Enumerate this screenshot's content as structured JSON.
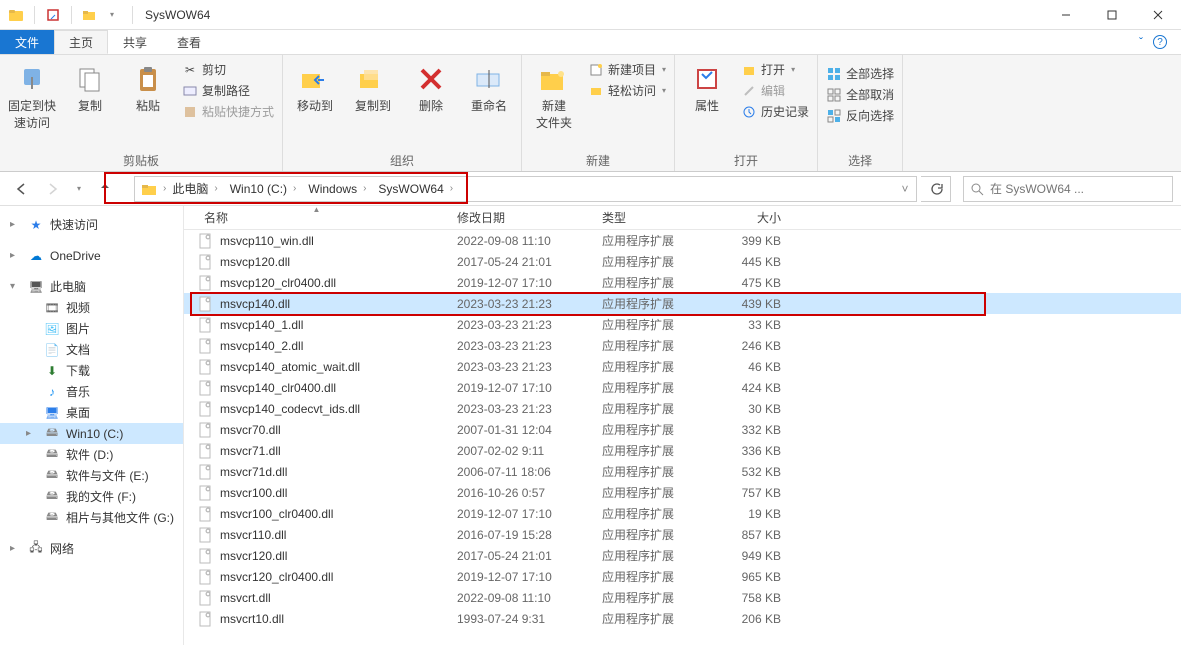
{
  "window": {
    "title": "SysWOW64"
  },
  "tabs": {
    "file": "文件",
    "home": "主页",
    "share": "共享",
    "view": "查看"
  },
  "ribbon": {
    "clipboard": {
      "pin": "固定到快\n速访问",
      "copy": "复制",
      "paste": "粘贴",
      "cut": "剪切",
      "copypath": "复制路径",
      "pasteshortcut": "粘贴快捷方式",
      "label": "剪贴板"
    },
    "organize": {
      "moveto": "移动到",
      "copyto": "复制到",
      "delete": "删除",
      "rename": "重命名",
      "label": "组织"
    },
    "new": {
      "newfolder": "新建\n文件夹",
      "newitem": "新建项目",
      "easyaccess": "轻松访问",
      "label": "新建"
    },
    "open": {
      "properties": "属性",
      "open": "打开",
      "edit": "编辑",
      "history": "历史记录",
      "label": "打开"
    },
    "select": {
      "selectall": "全部选择",
      "selectnone": "全部取消",
      "invert": "反向选择",
      "label": "选择"
    }
  },
  "breadcrumbs": [
    "此电脑",
    "Win10 (C:)",
    "Windows",
    "SysWOW64"
  ],
  "search_placeholder": "在 SysWOW64 ...",
  "columns": {
    "name": "名称",
    "date": "修改日期",
    "type": "类型",
    "size": "大小"
  },
  "sidebar": [
    {
      "label": "快速访问",
      "icon": "star",
      "exp": "▸",
      "lvl": 0,
      "color": "#2b7de9"
    },
    {
      "gap": true
    },
    {
      "label": "OneDrive",
      "icon": "cloud",
      "exp": "▸",
      "lvl": 0,
      "color": "#0078d4"
    },
    {
      "gap": true
    },
    {
      "label": "此电脑",
      "icon": "pc",
      "exp": "▾",
      "lvl": 0,
      "color": "#555"
    },
    {
      "label": "视频",
      "icon": "video",
      "lvl": 1,
      "color": "#555"
    },
    {
      "label": "图片",
      "icon": "pic",
      "lvl": 1,
      "color": "#4fc3f7"
    },
    {
      "label": "文档",
      "icon": "doc",
      "lvl": 1,
      "color": "#555"
    },
    {
      "label": "下载",
      "icon": "dl",
      "lvl": 1,
      "color": "#2e7d32"
    },
    {
      "label": "音乐",
      "icon": "music",
      "lvl": 1,
      "color": "#2196f3"
    },
    {
      "label": "桌面",
      "icon": "desktop",
      "lvl": 1,
      "color": "#2b7de9"
    },
    {
      "label": "Win10 (C:)",
      "icon": "drive",
      "exp": "▸",
      "lvl": 1,
      "selected": true,
      "color": "#888"
    },
    {
      "label": "软件 (D:)",
      "icon": "drive",
      "lvl": 1,
      "color": "#888"
    },
    {
      "label": "软件与文件 (E:)",
      "icon": "drive",
      "lvl": 1,
      "color": "#888"
    },
    {
      "label": "我的文件 (F:)",
      "icon": "drive",
      "lvl": 1,
      "color": "#888"
    },
    {
      "label": "相片与其他文件 (G:)",
      "icon": "drive",
      "lvl": 1,
      "color": "#888"
    },
    {
      "gap": true
    },
    {
      "label": "网络",
      "icon": "net",
      "exp": "▸",
      "lvl": 0,
      "color": "#555"
    }
  ],
  "files": [
    {
      "name": "msvcp110_win.dll",
      "date": "2022-09-08 11:10",
      "type": "应用程序扩展",
      "size": "399 KB"
    },
    {
      "name": "msvcp120.dll",
      "date": "2017-05-24 21:01",
      "type": "应用程序扩展",
      "size": "445 KB"
    },
    {
      "name": "msvcp120_clr0400.dll",
      "date": "2019-12-07 17:10",
      "type": "应用程序扩展",
      "size": "475 KB"
    },
    {
      "name": "msvcp140.dll",
      "date": "2023-03-23 21:23",
      "type": "应用程序扩展",
      "size": "439 KB",
      "selected": true
    },
    {
      "name": "msvcp140_1.dll",
      "date": "2023-03-23 21:23",
      "type": "应用程序扩展",
      "size": "33 KB"
    },
    {
      "name": "msvcp140_2.dll",
      "date": "2023-03-23 21:23",
      "type": "应用程序扩展",
      "size": "246 KB"
    },
    {
      "name": "msvcp140_atomic_wait.dll",
      "date": "2023-03-23 21:23",
      "type": "应用程序扩展",
      "size": "46 KB"
    },
    {
      "name": "msvcp140_clr0400.dll",
      "date": "2019-12-07 17:10",
      "type": "应用程序扩展",
      "size": "424 KB"
    },
    {
      "name": "msvcp140_codecvt_ids.dll",
      "date": "2023-03-23 21:23",
      "type": "应用程序扩展",
      "size": "30 KB"
    },
    {
      "name": "msvcr70.dll",
      "date": "2007-01-31 12:04",
      "type": "应用程序扩展",
      "size": "332 KB"
    },
    {
      "name": "msvcr71.dll",
      "date": "2007-02-02 9:11",
      "type": "应用程序扩展",
      "size": "336 KB"
    },
    {
      "name": "msvcr71d.dll",
      "date": "2006-07-11 18:06",
      "type": "应用程序扩展",
      "size": "532 KB"
    },
    {
      "name": "msvcr100.dll",
      "date": "2016-10-26 0:57",
      "type": "应用程序扩展",
      "size": "757 KB"
    },
    {
      "name": "msvcr100_clr0400.dll",
      "date": "2019-12-07 17:10",
      "type": "应用程序扩展",
      "size": "19 KB"
    },
    {
      "name": "msvcr110.dll",
      "date": "2016-07-19 15:28",
      "type": "应用程序扩展",
      "size": "857 KB"
    },
    {
      "name": "msvcr120.dll",
      "date": "2017-05-24 21:01",
      "type": "应用程序扩展",
      "size": "949 KB"
    },
    {
      "name": "msvcr120_clr0400.dll",
      "date": "2019-12-07 17:10",
      "type": "应用程序扩展",
      "size": "965 KB"
    },
    {
      "name": "msvcrt.dll",
      "date": "2022-09-08 11:10",
      "type": "应用程序扩展",
      "size": "758 KB"
    },
    {
      "name": "msvcrt10.dll",
      "date": "1993-07-24 9:31",
      "type": "应用程序扩展",
      "size": "206 KB"
    }
  ]
}
